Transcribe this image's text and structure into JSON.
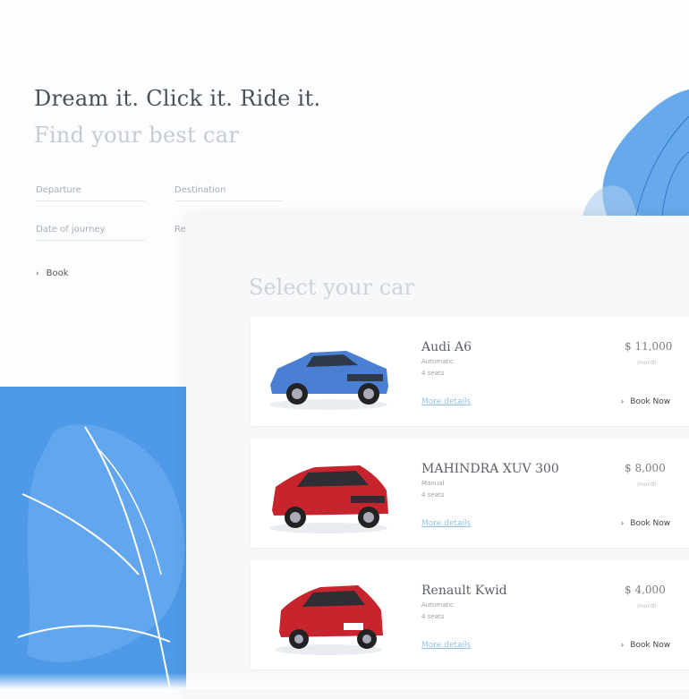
{
  "hero": {
    "title": "Dream it. Click it. Ride it.",
    "subtitle": "Find your best car"
  },
  "search_form": {
    "departure_placeholder": "Departure",
    "destination_placeholder": "Destination",
    "date_placeholder": "Date of journey",
    "return_placeholder": "Re",
    "book_label": "Book"
  },
  "selection": {
    "title": "Select your car",
    "cars": [
      {
        "name": "Audi A6",
        "transmission": "Automatic",
        "seats": "4 seats",
        "price": "$ 11,000",
        "per": "/month",
        "more_details": "More details",
        "book_label": "Book Now",
        "color": "#4a7fd4"
      },
      {
        "name": "MAHINDRA XUV 300",
        "transmission": "Manual",
        "seats": "4 seats",
        "price": "$ 8,000",
        "per": "/month",
        "more_details": "More details",
        "book_label": "Book Now",
        "color": "#c8242e"
      },
      {
        "name": "Renault Kwid",
        "transmission": "Automatic",
        "seats": "4 seats",
        "price": "$ 4,000",
        "per": "/month",
        "more_details": "More details",
        "book_label": "Book Now",
        "color": "#c8242e"
      }
    ]
  },
  "colors": {
    "accent_blue": "#4e9ae8",
    "link_blue": "#8fc0e8"
  }
}
